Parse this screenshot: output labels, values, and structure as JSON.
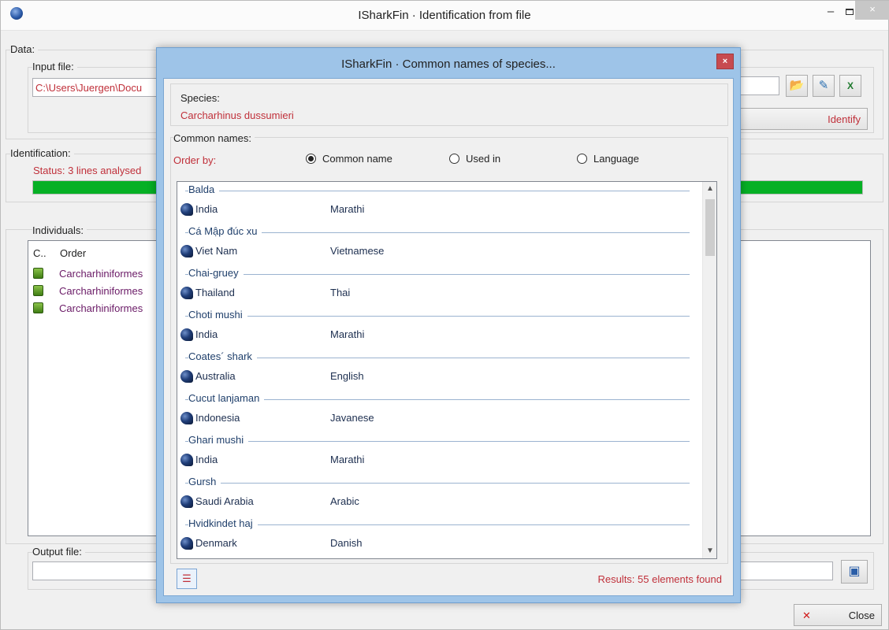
{
  "main": {
    "title": "ISharkFin · Identification from file",
    "data_group": "Data:",
    "input_file_label": "Input file:",
    "input_file_value": "C:\\Users\\Juergen\\Docu",
    "identify_label": "Identify",
    "identification_group": "Identification:",
    "status_text": "Status:  3 lines analysed",
    "progress_percent": 100,
    "individuals_label": "Individuals:",
    "columns": [
      "C..",
      "Order"
    ],
    "rows": [
      "Carcharhiniformes",
      "Carcharhiniformes",
      "Carcharhiniformes"
    ],
    "output_file_label": "Output file:",
    "close_label": "Close",
    "minimize_symbol": "–",
    "close_symbol": "×"
  },
  "dialog": {
    "title": "ISharkFin · Common names of species...",
    "close_symbol": "×",
    "species_label": "Species:",
    "species_value": "Carcharhinus dussumieri",
    "common_names_label": "Common names:",
    "order_by_label": "Order by:",
    "radios": [
      {
        "label": "Common name",
        "selected": true
      },
      {
        "label": "Used in",
        "selected": false
      },
      {
        "label": "Language",
        "selected": false
      }
    ],
    "groups": [
      {
        "name": "Balda",
        "country": "India",
        "language": "Marathi"
      },
      {
        "name": "Cá Mập đúc xu",
        "country": "Viet Nam",
        "language": "Vietnamese"
      },
      {
        "name": "Chai-gruey",
        "country": "Thailand",
        "language": "Thai"
      },
      {
        "name": "Choti mushi",
        "country": "India",
        "language": "Marathi"
      },
      {
        "name": "Coates´ shark",
        "country": "Australia",
        "language": "English"
      },
      {
        "name": "Cucut lanjaman",
        "country": "Indonesia",
        "language": "Javanese"
      },
      {
        "name": "Ghari mushi",
        "country": "India",
        "language": "Marathi"
      },
      {
        "name": "Gursh",
        "country": "Saudi Arabia",
        "language": "Arabic"
      },
      {
        "name": "Hvidkindet haj",
        "country": "Denmark",
        "language": "Danish"
      }
    ],
    "results_text": "Results: 55 elements found"
  },
  "icons": {
    "folder": "open-folder-icon",
    "note": "edit-note-icon",
    "excel": "excel-icon",
    "save": "save-disk-icon",
    "report": "report-icon",
    "country": "shark-fin-icon"
  }
}
